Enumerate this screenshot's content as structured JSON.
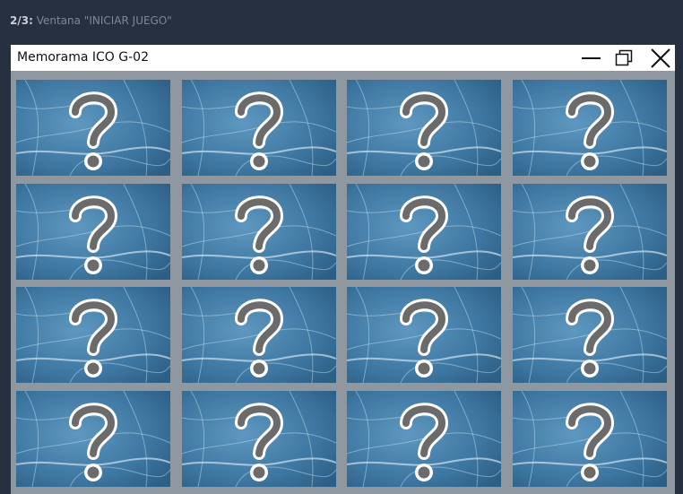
{
  "caption": {
    "step": "2/3:",
    "text": " Ventana \"INICIAR JUEGO\""
  },
  "window": {
    "title": "Memorama ICO G-02",
    "controls": [
      "minimize-icon",
      "maximize-icon",
      "close-icon"
    ]
  },
  "board": {
    "rows": 4,
    "columns": 4,
    "card_face": "question-mark-icon",
    "card_back_color": "#3f79a3"
  }
}
